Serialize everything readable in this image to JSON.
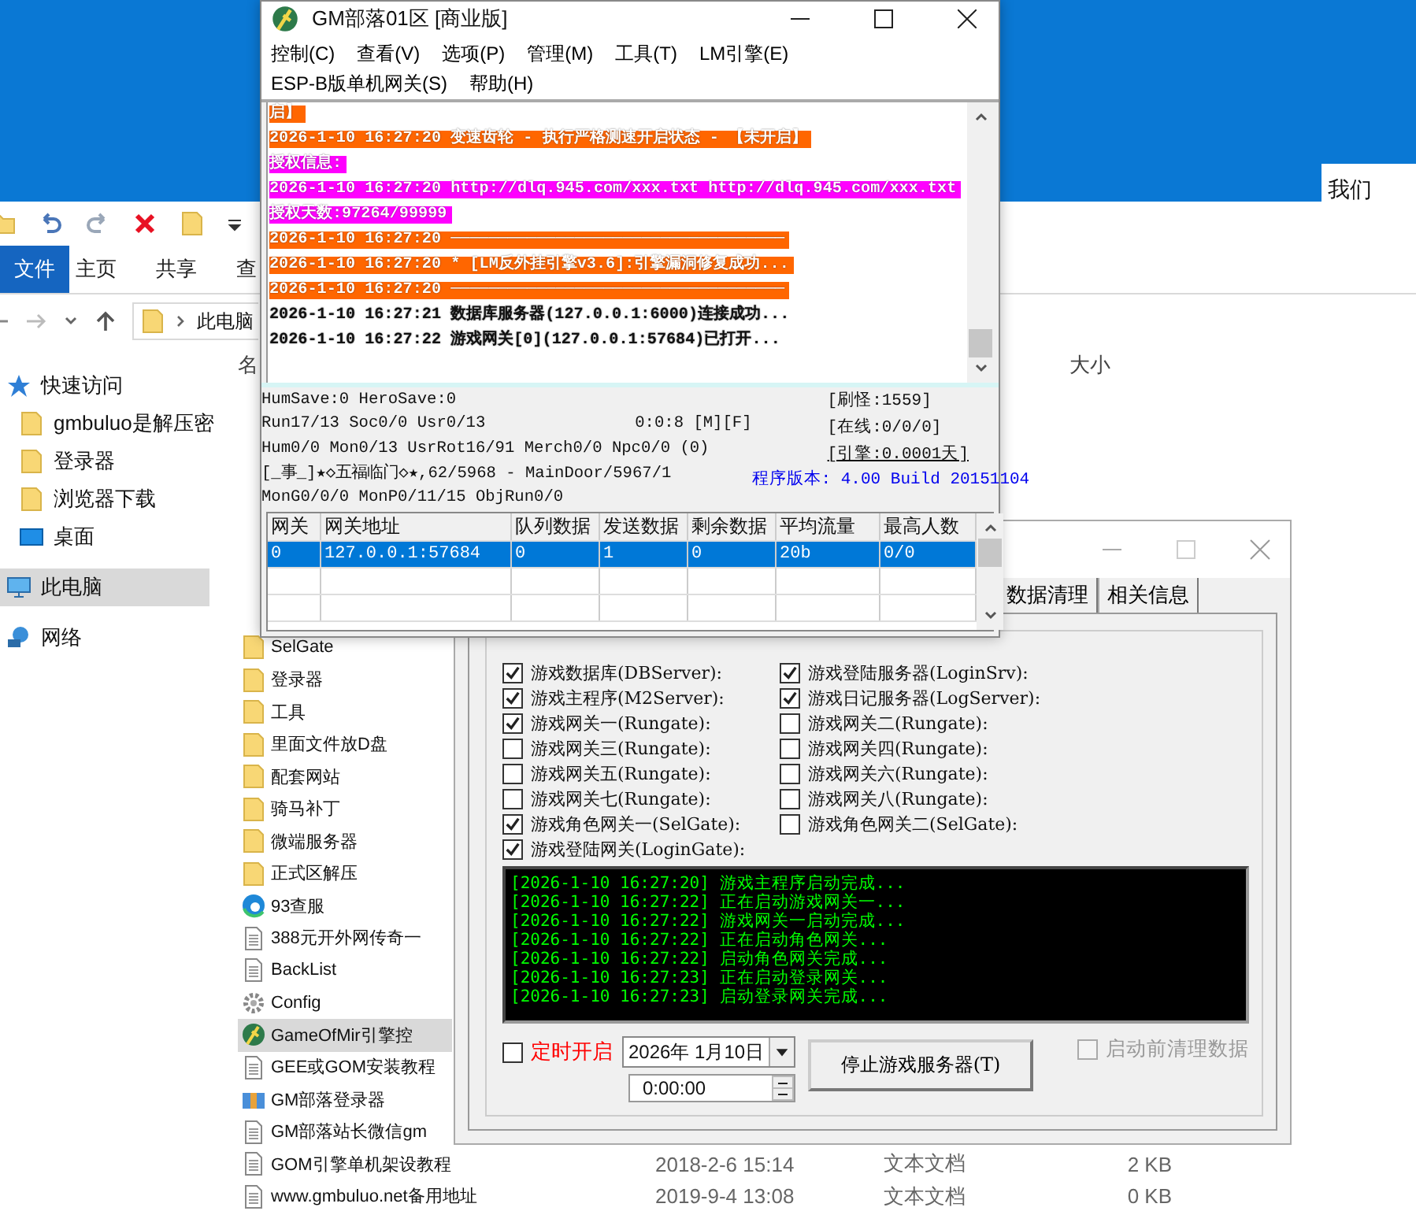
{
  "desktop": {
    "corner_text": "我们"
  },
  "explorer": {
    "ribbon_tabs": [
      {
        "label": "文件",
        "selected": true
      },
      {
        "label": "主页",
        "selected": false
      },
      {
        "label": "共享",
        "selected": false
      },
      {
        "label": "查",
        "selected": false
      }
    ],
    "address": "此电脑",
    "nav_pane": [
      {
        "label": "快速访问",
        "kind": "pinned",
        "selected": false
      },
      {
        "label": "gmbuluo是解压密",
        "kind": "folder",
        "selected": false
      },
      {
        "label": "登录器",
        "kind": "folder",
        "selected": false
      },
      {
        "label": "浏览器下载",
        "kind": "folder",
        "selected": false
      },
      {
        "label": "桌面",
        "kind": "desktop",
        "selected": false
      },
      {
        "label": "此电脑",
        "kind": "pc",
        "selected": true
      },
      {
        "label": "网络",
        "kind": "network",
        "selected": false
      }
    ],
    "columns": [
      "名",
      "大小"
    ],
    "files": [
      {
        "name": "SelGate",
        "kind": "folder",
        "selected": false
      },
      {
        "name": "登录器",
        "kind": "folder",
        "selected": false
      },
      {
        "name": "工具",
        "kind": "folder",
        "selected": false
      },
      {
        "name": "里面文件放D盘",
        "kind": "folder",
        "selected": false
      },
      {
        "name": "配套网站",
        "kind": "folder",
        "selected": false
      },
      {
        "name": "骑马补丁",
        "kind": "folder",
        "selected": false
      },
      {
        "name": "微端服务器",
        "kind": "folder",
        "selected": false
      },
      {
        "name": "正式区解压",
        "kind": "folder",
        "selected": false
      },
      {
        "name": "93查服",
        "kind": "browser",
        "selected": false
      },
      {
        "name": "388元开外网传奇一",
        "kind": "text",
        "selected": false
      },
      {
        "name": "BackList",
        "kind": "text",
        "selected": false
      },
      {
        "name": "Config",
        "kind": "config",
        "selected": false
      },
      {
        "name": "GameOfMir引擎控",
        "kind": "app",
        "selected": true
      },
      {
        "name": "GEE或GOM安装教程",
        "kind": "text",
        "selected": false
      },
      {
        "name": "GM部落登录器",
        "kind": "archive",
        "selected": false
      },
      {
        "name": "GM部落站长微信gm",
        "kind": "text",
        "selected": false
      },
      {
        "name": "GOM引擎单机架设教程",
        "kind": "text",
        "selected": false,
        "date": "2018-2-6 15:14",
        "type": "文本文档",
        "size": "2 KB"
      },
      {
        "name": "www.gmbuluo.net备用地址",
        "kind": "text",
        "selected": false,
        "date": "2019-9-4 13:08",
        "type": "文本文档",
        "size": "0 KB"
      }
    ]
  },
  "server_window": {
    "title": "GM部落01区 [商业版]",
    "menu_rows": [
      [
        "控制(C)",
        "查看(V)",
        "选项(P)",
        "管理(M)",
        "工具(T)",
        "LM引擎(E)"
      ],
      [
        "ESP-B版单机网关(S)",
        "帮助(H)"
      ]
    ],
    "log": [
      {
        "text": "启】",
        "color": "#ff6600"
      },
      {
        "text": "2026-1-10 16:27:20 变速齿轮 - 执行严格测速开启状态 - 【未开启】",
        "color": "#ff6600"
      },
      {
        "text": "授权信息:",
        "color": "#ff00ff"
      },
      {
        "text": "2026-1-10 16:27:20 http://dlq.945.com/xxx.txt http://dlq.945.com/xxx.txt",
        "color": "#ff00ff"
      },
      {
        "text": "授权天数:97264/99999",
        "color": "#ff00ff"
      },
      {
        "text": "2026-1-10 16:27:20 ───────────────────────────────────",
        "color": "#ff6600"
      },
      {
        "text": "2026-1-10 16:27:20 * [LM反外挂引擎v3.6]:引擎漏洞修复成功...",
        "color": "#ff6600"
      },
      {
        "text": "2026-1-10 16:27:20 ───────────────────────────────────",
        "color": "#ff6600"
      },
      {
        "text": "2026-1-10 16:27:21 数据库服务器(127.0.0.1:6000)连接成功..."
      },
      {
        "text": "2026-1-10 16:27:22 游戏网关[0](127.0.0.1:57684)已打开..."
      }
    ],
    "status_lines": [
      "HumSave:0 HeroSave:0",
      "Run17/13 Soc0/0 Usr0/13",
      "Hum0/0 Mon0/13 UsrRot16/91 Merch0/0 Npc0/0 (0)",
      "[_事_]★◇五福临门◇★,62/5968 - MainDoor/5967/1",
      "MonG0/0/0 MonP0/11/15 ObjRun0/0"
    ],
    "run_time": "0:0:8 [M][F]",
    "counters": [
      "[刷怪:1559]",
      "[在线:0/0/0]",
      "[引擎:0.0001天]"
    ],
    "version": "程序版本: 4.00 Build 20151104",
    "table": {
      "columns": [
        "网关",
        "网关地址",
        "队列数据",
        "发送数据",
        "剩余数据",
        "平均流量",
        "最高人数"
      ],
      "rows": [
        {
          "cells": [
            "0",
            "127.0.0.1:57684",
            "0",
            "1",
            "0",
            "20b",
            "0/0"
          ],
          "selected": true
        }
      ]
    }
  },
  "control_window": {
    "tabs": [
      {
        "label": "数据清理",
        "selected": false
      },
      {
        "label": "相关信息",
        "selected": false
      }
    ],
    "servers": [
      {
        "label": "游戏数据库(DBServer):",
        "checked": true
      },
      {
        "label": "游戏登陆服务器(LoginSrv):",
        "checked": true
      },
      {
        "label": "游戏主程序(M2Server):",
        "checked": true
      },
      {
        "label": "游戏日记服务器(LogServer):",
        "checked": true
      },
      {
        "label": "游戏网关一(Rungate):",
        "checked": true
      },
      {
        "label": "游戏网关二(Rungate):",
        "checked": false
      },
      {
        "label": "游戏网关三(Rungate):",
        "checked": false
      },
      {
        "label": "游戏网关四(Rungate):",
        "checked": false
      },
      {
        "label": "游戏网关五(Rungate):",
        "checked": false
      },
      {
        "label": "游戏网关六(Rungate):",
        "checked": false
      },
      {
        "label": "游戏网关七(Rungate):",
        "checked": false
      },
      {
        "label": "游戏网关八(Rungate):",
        "checked": false
      },
      {
        "label": "游戏角色网关一(SelGate):",
        "checked": true
      },
      {
        "label": "游戏角色网关二(SelGate):",
        "checked": false
      },
      {
        "label": "游戏登陆网关(LoginGate):",
        "checked": true
      }
    ],
    "console": [
      "[2026-1-10 16:27:20] 游戏主程序启动完成...",
      "[2026-1-10 16:27:22] 正在启动游戏网关一...",
      "[2026-1-10 16:27:22] 游戏网关一启动完成...",
      "[2026-1-10 16:27:22] 正在启动角色网关...",
      "[2026-1-10 16:27:22] 启动角色网关完成...",
      "[2026-1-10 16:27:23] 正在启动登录网关...",
      "[2026-1-10 16:27:23] 启动登录网关完成..."
    ],
    "timer": {
      "label": "定时开启",
      "checked": false
    },
    "date": "2026年 1月10日",
    "time": "0:00:00",
    "stop_button": "停止游戏服务器(T)",
    "clean": {
      "label": "启动前清理数据",
      "checked": false,
      "disabled": true
    }
  }
}
